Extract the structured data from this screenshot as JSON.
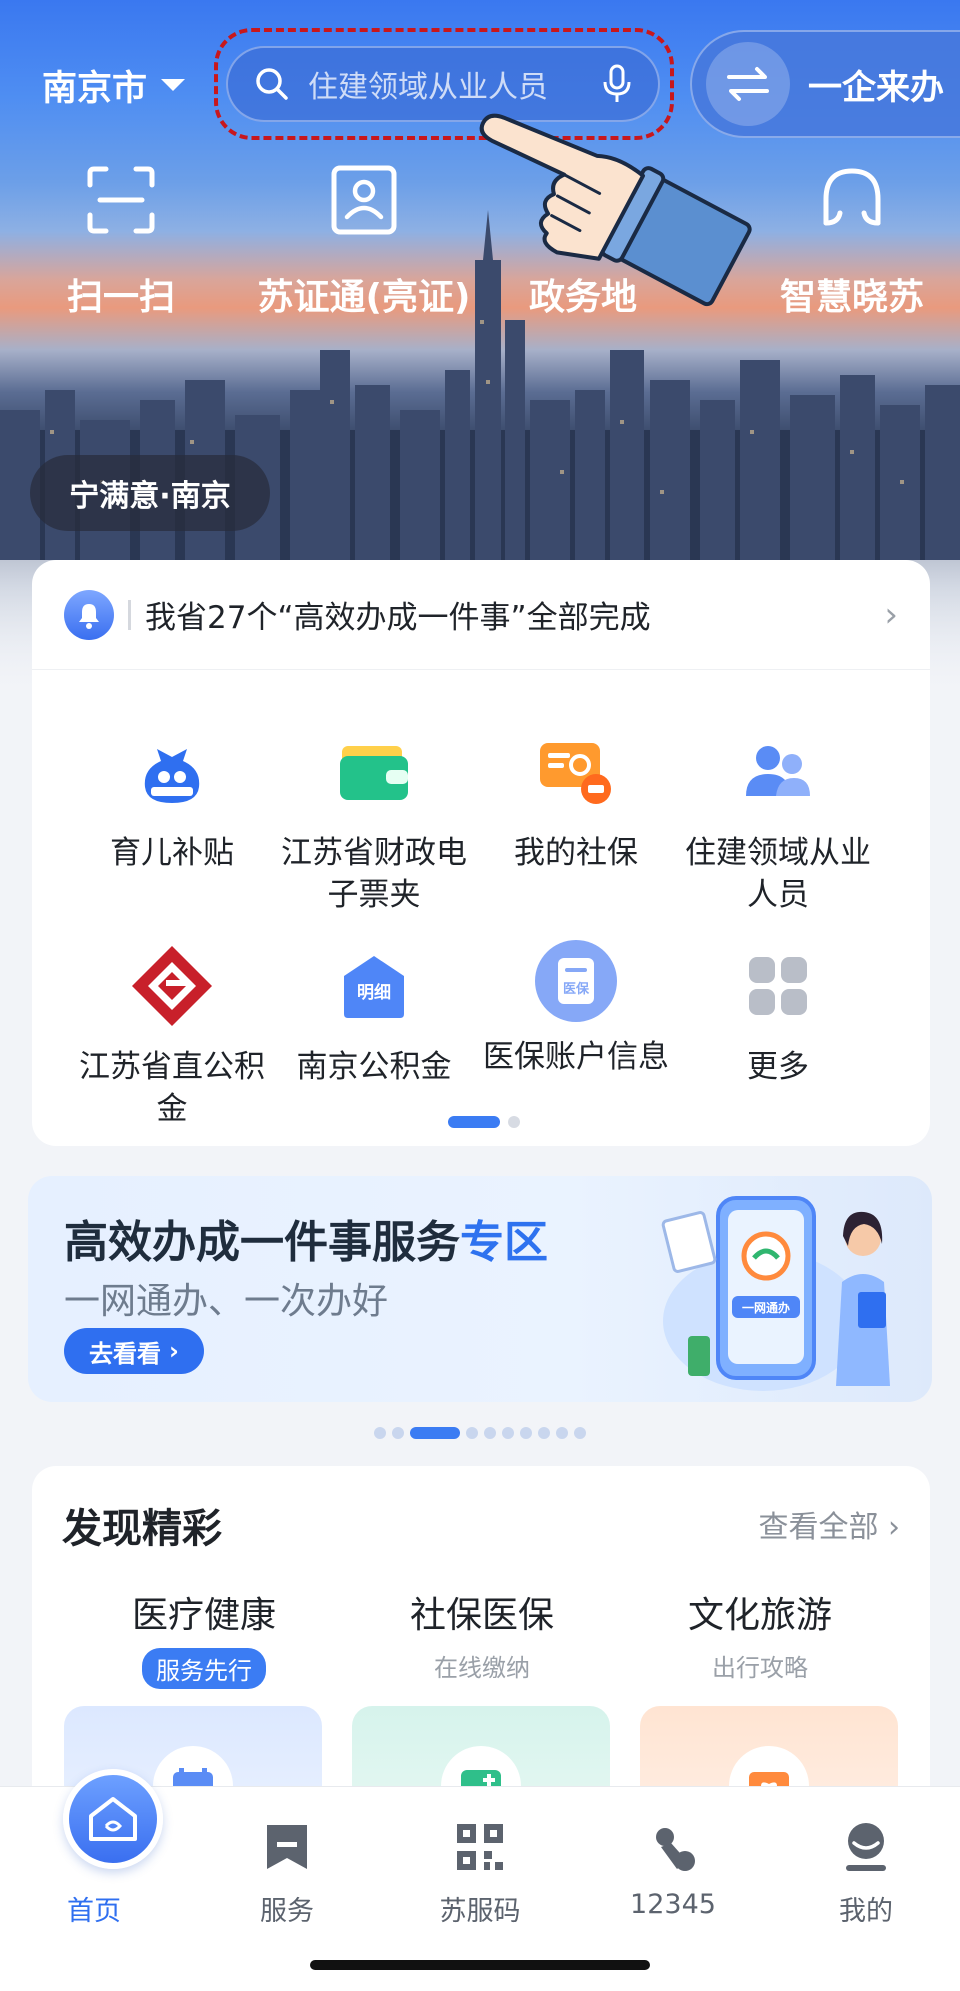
{
  "header": {
    "city": "南京市",
    "search_placeholder": "住建领域从业人员",
    "enterprise_label": "一企来办"
  },
  "quick_actions": [
    {
      "label": "扫一扫",
      "icon": "scan-icon"
    },
    {
      "label": "苏证通(亮证)",
      "icon": "id-card-icon"
    },
    {
      "label": "政务地",
      "icon": "map-icon"
    },
    {
      "label": "智慧晓苏",
      "icon": "assistant-icon"
    }
  ],
  "hero_tag": "宁满意·南京",
  "notice": {
    "text": "我省27个“高效办成一件事”全部完成"
  },
  "services": [
    {
      "label": "育儿补贴",
      "icon": "childcare-subsidy-icon"
    },
    {
      "label": "江苏省财政电子票夹",
      "icon": "wallet-icon"
    },
    {
      "label": "我的社保",
      "icon": "social-security-icon"
    },
    {
      "label": "住建领域从业人员",
      "icon": "people-icon"
    },
    {
      "label": "江苏省直公积金",
      "icon": "provident-fund-logo-icon"
    },
    {
      "label": "南京公积金",
      "icon": "house-detail-icon",
      "icon_text": "明细"
    },
    {
      "label": "医保账户信息",
      "icon": "medical-insurance-icon",
      "icon_text": "医保"
    },
    {
      "label": "更多",
      "icon": "more-grid-icon"
    }
  ],
  "banner": {
    "title_main": "高效办成一件事服务",
    "title_highlight": "专区",
    "subtitle": "一网通办、一次办好",
    "button": "去看看",
    "art_text": "一网通办"
  },
  "discover": {
    "title": "发现精彩",
    "view_all": "查看全部",
    "columns": [
      {
        "title": "医疗健康",
        "subtitle": "服务先行",
        "badge": true
      },
      {
        "title": "社保医保",
        "subtitle": "在线缴纳",
        "badge": false
      },
      {
        "title": "文化旅游",
        "subtitle": "出行攻略",
        "badge": false
      }
    ]
  },
  "tabbar": [
    {
      "label": "首页",
      "icon": "home-icon",
      "active": true
    },
    {
      "label": "服务",
      "icon": "service-icon",
      "active": false
    },
    {
      "label": "苏服码",
      "icon": "qr-code-icon",
      "active": false
    },
    {
      "label": "12345",
      "icon": "hotline-icon",
      "active": false
    },
    {
      "label": "我的",
      "icon": "profile-icon",
      "active": false
    }
  ],
  "colors": {
    "accent": "#2f6ff0",
    "highlight_outline": "#c8171c"
  }
}
